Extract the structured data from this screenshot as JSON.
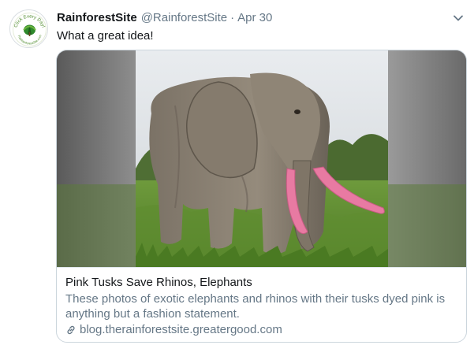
{
  "tweet": {
    "display_name": "RainforestSite",
    "handle": "@RainforestSite",
    "separator": "·",
    "date": "Apr 30",
    "text": "What a great idea!"
  },
  "avatar": {
    "logo_text_top": "Click Every Day!",
    "logo_text_bottom": "TheRainforestSite.com"
  },
  "card": {
    "title": "Pink Tusks Save Rhinos, Elephants",
    "description": "These photos of exotic elephants and rhinos with their tusks dyed pink is anything but a fashion statement.",
    "domain": "blog.therainforestsite.greatergood.com",
    "image_icon": "elephant-with-pink-tusks-photo"
  },
  "icons": {
    "caret": "chevron-down-icon",
    "link": "link-icon"
  },
  "colors": {
    "text_primary": "#14171a",
    "text_secondary": "#657786",
    "border": "#ccd6dd",
    "tusk_pink": "#e87aa2"
  }
}
